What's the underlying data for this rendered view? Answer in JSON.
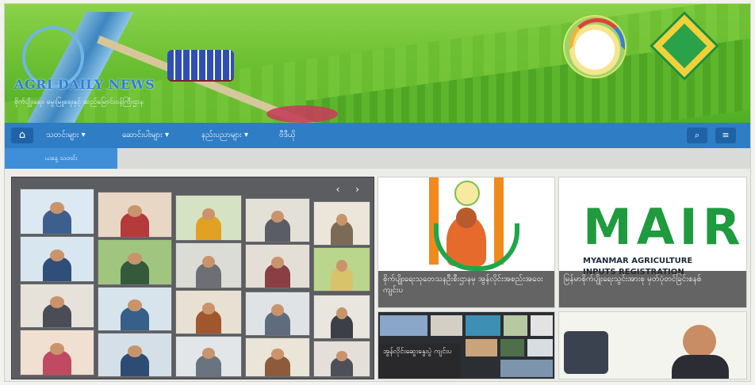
{
  "site": {
    "brand": "AGRI DAILY NEWS",
    "tagline": "စိုက်ပျိုးရေး၊ မွေးမြူရေးနှင့် ဆည်မြောင်းဝန်ကြီးဌာန"
  },
  "nav": {
    "home_icon": "⌂",
    "items": [
      {
        "label": "သတင်းများ ▾"
      },
      {
        "label": "ဆောင်းပါးများ ▾"
      },
      {
        "label": "နည်းပညာများ ▾"
      },
      {
        "label": "ဗီဒီယို"
      }
    ],
    "search_icon": "⌕",
    "menu_icon": "≡",
    "sub_tab": "ယနေ့ သတင်း"
  },
  "slider": {
    "arrows": "‹ ›"
  },
  "cards": [
    {
      "caption": "စိုက်ပျိုးရေးသုတေသနဦးစီးဌာနမှ အွန်လိုင်းအစည်းအဝေး ကျင်းပ"
    },
    {
      "title": "MAIR",
      "line1": "MYANMAR AGRICULTURE",
      "line2": "INPUTS REGISTRATION",
      "caption": "မြန်မာစိုက်ပျိုးရေးသွင်းအားစု မှတ်ပုံတင်ခြင်းစနစ်"
    },
    {
      "caption": "အွန်လိုင်းဆွေးနွေးပွဲ ကျင်းပ"
    },
    {
      "caption": ""
    }
  ]
}
